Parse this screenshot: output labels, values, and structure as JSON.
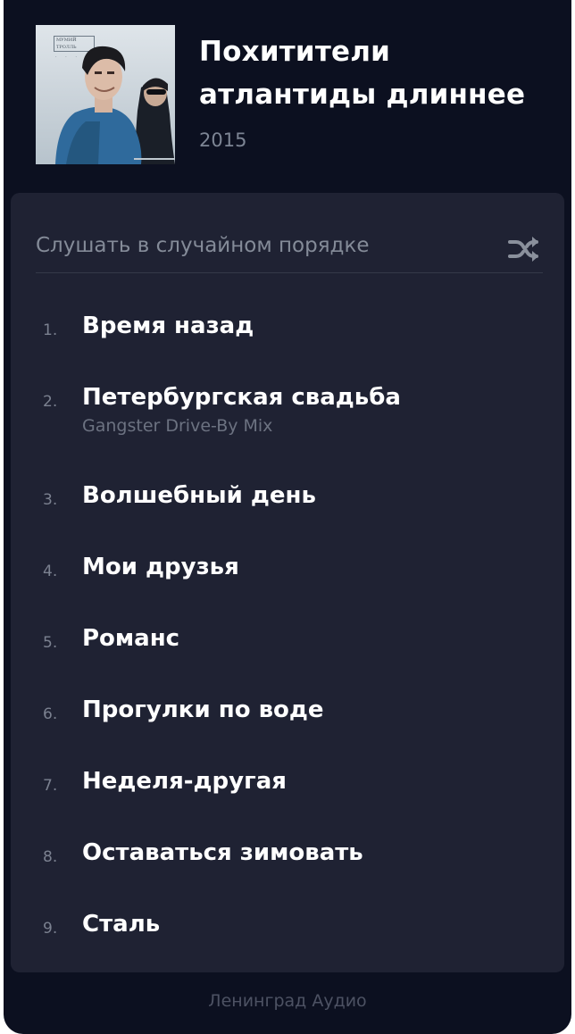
{
  "album": {
    "title": "Похитители атлантиды длиннее",
    "year": "2015",
    "cover_lettering": "МУМИЙ ТРОЛЛЬ"
  },
  "shuffle": {
    "label": "Слушать в случайном порядке",
    "icon": "shuffle-icon"
  },
  "tracks": [
    {
      "num": "1.",
      "name": "Время назад",
      "sub": ""
    },
    {
      "num": "2.",
      "name": "Петербургская свадьба",
      "sub": "Gangster Drive-By Mix"
    },
    {
      "num": "3.",
      "name": "Волшебный день",
      "sub": ""
    },
    {
      "num": "4.",
      "name": "Мои друзья",
      "sub": ""
    },
    {
      "num": "5.",
      "name": "Романс",
      "sub": ""
    },
    {
      "num": "6.",
      "name": "Прогулки по воде",
      "sub": ""
    },
    {
      "num": "7.",
      "name": "Неделя-другая",
      "sub": ""
    },
    {
      "num": "8.",
      "name": "Оставаться зимовать",
      "sub": ""
    },
    {
      "num": "9.",
      "name": "Сталь",
      "sub": ""
    }
  ],
  "footer": {
    "label": "Ленинград Аудио"
  },
  "colors": {
    "background": "#0c1020",
    "panel": "#1f2233",
    "text_primary": "#ffffff",
    "text_secondary": "#848b98"
  }
}
